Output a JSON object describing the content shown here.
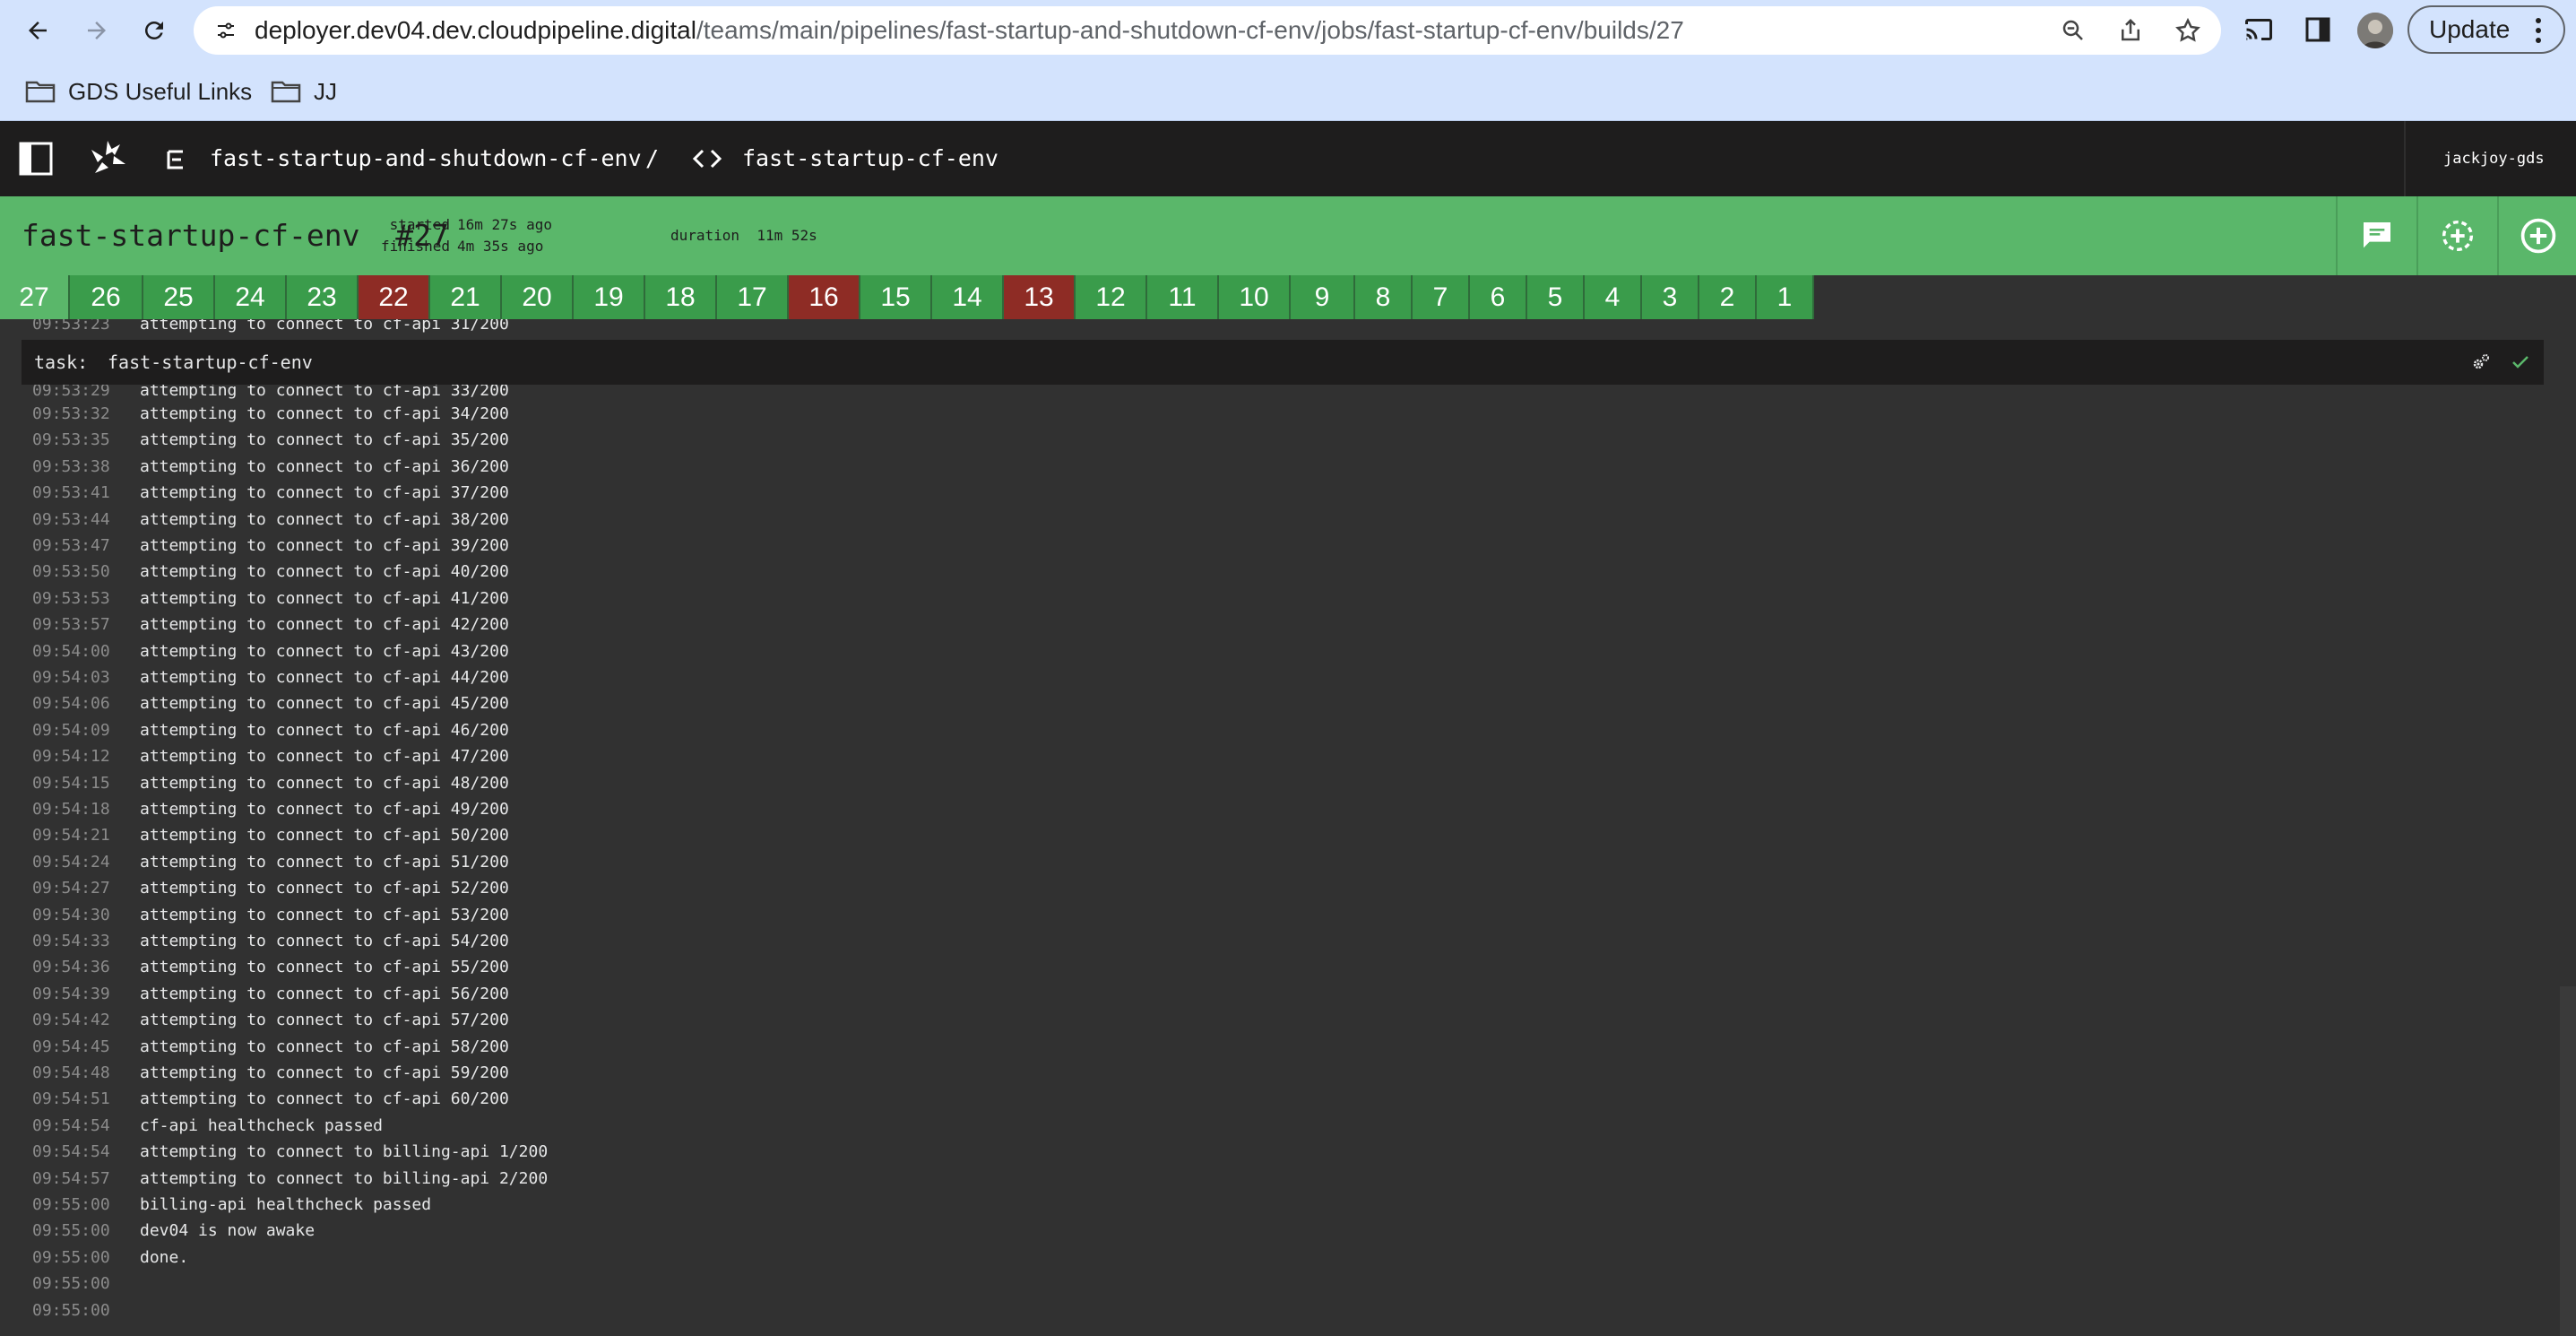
{
  "browser": {
    "url_host": "deployer.dev04.dev.cloudpipeline.digital",
    "url_path": "/teams/main/pipelines/fast-startup-and-shutdown-cf-env/jobs/fast-startup-cf-env/builds/27",
    "update_label": "Update",
    "bookmarks": [
      "GDS Useful Links",
      "JJ"
    ]
  },
  "breadcrumb": {
    "pipeline": "fast-startup-and-shutdown-cf-env",
    "separator": "/",
    "job": "fast-startup-cf-env"
  },
  "user": "jackjoy-gds",
  "build": {
    "job_name": "fast-startup-cf-env",
    "number": "#27",
    "started_label": "started",
    "started_value": "16m 27s ago",
    "finished_label": "finished",
    "finished_value": "4m 35s ago",
    "duration_label": "duration",
    "duration_value": "11m 52s",
    "status_color": "#5ab76a"
  },
  "builds": [
    {
      "n": "27",
      "status": "current"
    },
    {
      "n": "26",
      "status": "succeeded"
    },
    {
      "n": "25",
      "status": "succeeded"
    },
    {
      "n": "24",
      "status": "succeeded"
    },
    {
      "n": "23",
      "status": "succeeded"
    },
    {
      "n": "22",
      "status": "failed"
    },
    {
      "n": "21",
      "status": "succeeded"
    },
    {
      "n": "20",
      "status": "succeeded"
    },
    {
      "n": "19",
      "status": "succeeded"
    },
    {
      "n": "18",
      "status": "succeeded"
    },
    {
      "n": "17",
      "status": "succeeded"
    },
    {
      "n": "16",
      "status": "failed"
    },
    {
      "n": "15",
      "status": "succeeded"
    },
    {
      "n": "14",
      "status": "succeeded"
    },
    {
      "n": "13",
      "status": "failed"
    },
    {
      "n": "12",
      "status": "succeeded"
    },
    {
      "n": "11",
      "status": "succeeded"
    },
    {
      "n": "10",
      "status": "succeeded"
    },
    {
      "n": "9",
      "status": "succeeded"
    },
    {
      "n": "8",
      "status": "succeeded"
    },
    {
      "n": "7",
      "status": "succeeded"
    },
    {
      "n": "6",
      "status": "succeeded"
    },
    {
      "n": "5",
      "status": "succeeded"
    },
    {
      "n": "4",
      "status": "succeeded"
    },
    {
      "n": "3",
      "status": "succeeded"
    },
    {
      "n": "2",
      "status": "succeeded"
    },
    {
      "n": "1",
      "status": "succeeded"
    }
  ],
  "task": {
    "label": "task:",
    "name": "fast-startup-cf-env"
  },
  "log_top": {
    "ts": "09:53:23",
    "text": "attempting to connect to cf-api 31/200"
  },
  "log_partial": {
    "ts": "09:53:29",
    "text": "attempting to connect to cf-api 33/200"
  },
  "log": [
    {
      "ts": "09:53:32",
      "text": "attempting to connect to cf-api 34/200"
    },
    {
      "ts": "09:53:35",
      "text": "attempting to connect to cf-api 35/200"
    },
    {
      "ts": "09:53:38",
      "text": "attempting to connect to cf-api 36/200"
    },
    {
      "ts": "09:53:41",
      "text": "attempting to connect to cf-api 37/200"
    },
    {
      "ts": "09:53:44",
      "text": "attempting to connect to cf-api 38/200"
    },
    {
      "ts": "09:53:47",
      "text": "attempting to connect to cf-api 39/200"
    },
    {
      "ts": "09:53:50",
      "text": "attempting to connect to cf-api 40/200"
    },
    {
      "ts": "09:53:53",
      "text": "attempting to connect to cf-api 41/200"
    },
    {
      "ts": "09:53:57",
      "text": "attempting to connect to cf-api 42/200"
    },
    {
      "ts": "09:54:00",
      "text": "attempting to connect to cf-api 43/200"
    },
    {
      "ts": "09:54:03",
      "text": "attempting to connect to cf-api 44/200"
    },
    {
      "ts": "09:54:06",
      "text": "attempting to connect to cf-api 45/200"
    },
    {
      "ts": "09:54:09",
      "text": "attempting to connect to cf-api 46/200"
    },
    {
      "ts": "09:54:12",
      "text": "attempting to connect to cf-api 47/200"
    },
    {
      "ts": "09:54:15",
      "text": "attempting to connect to cf-api 48/200"
    },
    {
      "ts": "09:54:18",
      "text": "attempting to connect to cf-api 49/200"
    },
    {
      "ts": "09:54:21",
      "text": "attempting to connect to cf-api 50/200"
    },
    {
      "ts": "09:54:24",
      "text": "attempting to connect to cf-api 51/200"
    },
    {
      "ts": "09:54:27",
      "text": "attempting to connect to cf-api 52/200"
    },
    {
      "ts": "09:54:30",
      "text": "attempting to connect to cf-api 53/200"
    },
    {
      "ts": "09:54:33",
      "text": "attempting to connect to cf-api 54/200"
    },
    {
      "ts": "09:54:36",
      "text": "attempting to connect to cf-api 55/200"
    },
    {
      "ts": "09:54:39",
      "text": "attempting to connect to cf-api 56/200"
    },
    {
      "ts": "09:54:42",
      "text": "attempting to connect to cf-api 57/200"
    },
    {
      "ts": "09:54:45",
      "text": "attempting to connect to cf-api 58/200"
    },
    {
      "ts": "09:54:48",
      "text": "attempting to connect to cf-api 59/200"
    },
    {
      "ts": "09:54:51",
      "text": "attempting to connect to cf-api 60/200"
    },
    {
      "ts": "09:54:54",
      "text": "cf-api healthcheck passed"
    },
    {
      "ts": "09:54:54",
      "text": "attempting to connect to billing-api 1/200"
    },
    {
      "ts": "09:54:57",
      "text": "attempting to connect to billing-api 2/200"
    },
    {
      "ts": "09:55:00",
      "text": "billing-api healthcheck passed"
    },
    {
      "ts": "09:55:00",
      "text": "dev04 is now awake"
    },
    {
      "ts": "09:55:00",
      "text": "done."
    },
    {
      "ts": "09:55:00",
      "text": ""
    },
    {
      "ts": "09:55:00",
      "text": ""
    }
  ],
  "icons": {
    "back": "arrow-left-icon",
    "forward": "arrow-right-icon",
    "reload": "reload-icon",
    "comment": "comment-icon",
    "rerun": "rerun-icon",
    "trigger": "add-icon",
    "task_success": "check-icon"
  }
}
